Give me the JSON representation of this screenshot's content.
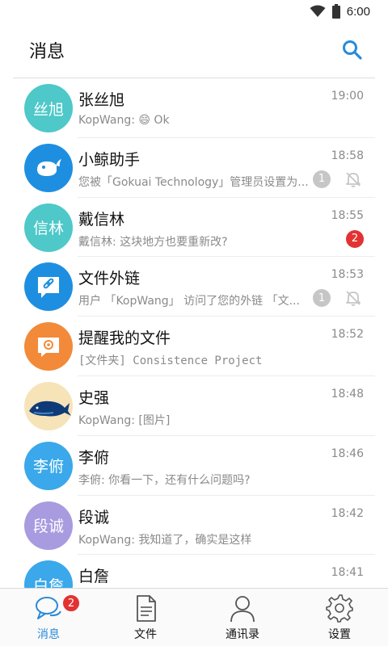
{
  "status_bar": {
    "time": "6:00"
  },
  "header": {
    "title": "消息"
  },
  "conversations": [
    {
      "name": "张丝旭",
      "preview": "KopWang: 😄 Ok",
      "time": "19:00",
      "avatar_text": "丝旭",
      "avatar_color": "#4ec8c8"
    },
    {
      "name": "小鲸助手",
      "preview": "您被「Gokuai Technology」管理员设置为...",
      "time": "18:58",
      "avatar_text": "",
      "avatar_color": "#1e8fe0",
      "gray_badge": "1"
    },
    {
      "name": "戴信林",
      "preview": "戴信林: 这块地方也要重新改?",
      "time": "18:55",
      "avatar_text": "信林",
      "avatar_color": "#4ec8c8",
      "red_badge": "2"
    },
    {
      "name": "文件外链",
      "preview": "用户 「KopWang」 访问了您的外链 「文...",
      "time": "18:53",
      "avatar_text": "",
      "avatar_color": "#1e8fe0",
      "gray_badge": "1"
    },
    {
      "name": "提醒我的文件",
      "preview": "[文件夹] Consistence Project",
      "time": "18:52",
      "avatar_text": "",
      "avatar_color": "#f28a3a"
    },
    {
      "name": "史强",
      "preview": "KopWang: [图片]",
      "time": "18:48",
      "avatar_text": "",
      "avatar_color": "#f6e3b8"
    },
    {
      "name": "李俯",
      "preview": "李俯: 你看一下，还有什么问题吗?",
      "time": "18:46",
      "avatar_text": "李俯",
      "avatar_color": "#3aa8ea"
    },
    {
      "name": "段诚",
      "preview": "KopWang: 我知道了，确实是这样",
      "time": "18:42",
      "avatar_text": "段诚",
      "avatar_color": "#a89be0"
    },
    {
      "name": "白詹",
      "preview": "",
      "time": "18:41",
      "avatar_text": "白詹",
      "avatar_color": "#3aa8ea"
    }
  ],
  "tabs": [
    {
      "label": "消息",
      "badge": "2"
    },
    {
      "label": "文件"
    },
    {
      "label": "通讯录"
    },
    {
      "label": "设置"
    }
  ],
  "colors": {
    "accent": "#2a8ad8",
    "badge_red": "#e33232",
    "badge_gray": "#c6c6c6"
  },
  "icons": [
    "wifi-icon",
    "battery-icon",
    "search-icon",
    "whale-icon",
    "link-icon",
    "at-mail-icon",
    "mute-bell-icon",
    "chat-icon",
    "document-icon",
    "person-icon",
    "gear-icon"
  ]
}
